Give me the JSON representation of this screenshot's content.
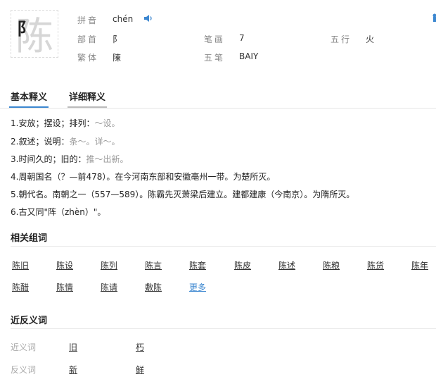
{
  "header": {
    "character": "陈",
    "corner_mark": "阝",
    "pinyin_label": "拼音",
    "pinyin_value": "chén",
    "radical_label": "部首",
    "radical_value": "阝",
    "strokes_label": "笔画",
    "strokes_value": "7",
    "wuxing_label": "五行",
    "wuxing_value": "火",
    "traditional_label": "繁体",
    "traditional_value": "陳",
    "wubi_label": "五笔",
    "wubi_value": "BAIY",
    "sound_icon": "speaker-icon",
    "accent_color": "#3c87d0"
  },
  "tabs": [
    {
      "label": "基本释义",
      "active": true
    },
    {
      "label": "详细释义",
      "active": false
    }
  ],
  "definitions": [
    {
      "text": "1.安放；摆设；排列：",
      "example": "～设。"
    },
    {
      "text": "2.叙述；说明：",
      "example": "条～。详～。"
    },
    {
      "text": "3.时间久的；旧的：",
      "example": "推～出新。"
    },
    {
      "text": "4.周朝国名（？—前478）。在今河南东部和安徽亳州一带。为楚所灭。",
      "example": ""
    },
    {
      "text": "5.朝代名。南朝之一（557—589）。陈霸先灭萧梁后建立。建都建康（今南京）。为隋所灭。",
      "example": ""
    },
    {
      "text": "6.古又同\"阵（zhèn）\"。",
      "example": ""
    }
  ],
  "related": {
    "title": "相关组词",
    "words": [
      "陈旧",
      "陈设",
      "陈列",
      "陈言",
      "陈套",
      "陈皮",
      "陈述",
      "陈粮",
      "陈货",
      "陈年",
      "陈醋",
      "陈情",
      "陈请",
      "敷陈"
    ],
    "more": "更多"
  },
  "synonyms": {
    "title": "近反义词",
    "near_label": "近义词",
    "near_words": [
      "旧",
      "朽"
    ],
    "anti_label": "反义词",
    "anti_words": [
      "新",
      "鲜"
    ]
  }
}
